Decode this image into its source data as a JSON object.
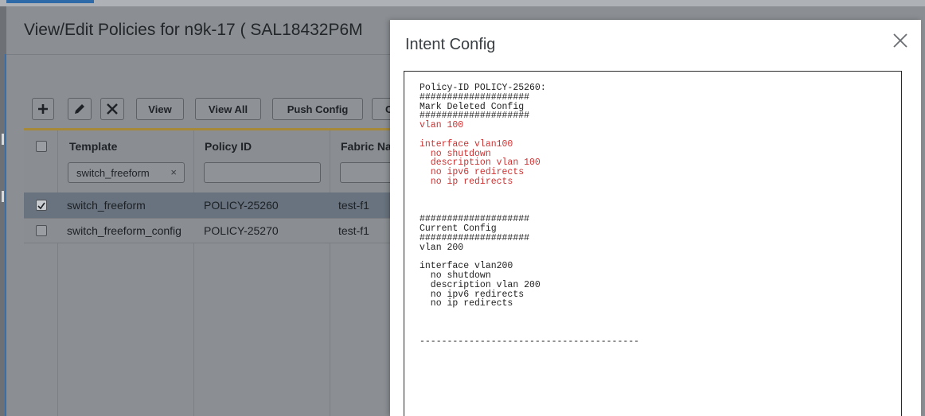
{
  "background_dialog": {
    "title": "View/Edit Policies for n9k-17 ( SAL18432P6M",
    "toolbar": {
      "add_icon": "plus-icon",
      "edit_icon": "pencil-icon",
      "delete_icon": "x-icon",
      "view_label": "View",
      "view_all_label": "View All",
      "push_config_label": "Push Config",
      "partial_label": "C"
    },
    "table": {
      "columns": [
        "Template",
        "Policy ID",
        "Fabric Na"
      ],
      "template_filter_value": "switch_freeform",
      "template_filter_clear": "×",
      "rows": [
        {
          "checked": true,
          "template": "switch_freeform",
          "policy_id": "POLICY-25260",
          "fabric": "test-f1"
        },
        {
          "checked": false,
          "template": "switch_freeform_config",
          "policy_id": "POLICY-25270",
          "fabric": "test-f1"
        }
      ]
    }
  },
  "modal": {
    "title": "Intent Config",
    "close_icon": "close-icon",
    "config": {
      "policy_line": "Policy-ID POLICY-25260:",
      "hash_line": "####################",
      "mark_deleted_heading": "Mark Deleted Config",
      "deleted_lines": [
        "vlan 100",
        "",
        "interface vlan100",
        "  no shutdown",
        "  description vlan 100",
        "  no ipv6 redirects",
        "  no ip redirects"
      ],
      "current_heading": "Current Config",
      "current_lines": [
        "vlan 200",
        "",
        "interface vlan200",
        "  no shutdown",
        "  description vlan 200",
        "  no ipv6 redirects",
        "  no ip redirects"
      ],
      "footer_rule": "----------------------------------------"
    }
  },
  "colors": {
    "deleted_text": "#cc3333",
    "selected_row": "#68737f",
    "accent_gold": "#a68a3a"
  }
}
